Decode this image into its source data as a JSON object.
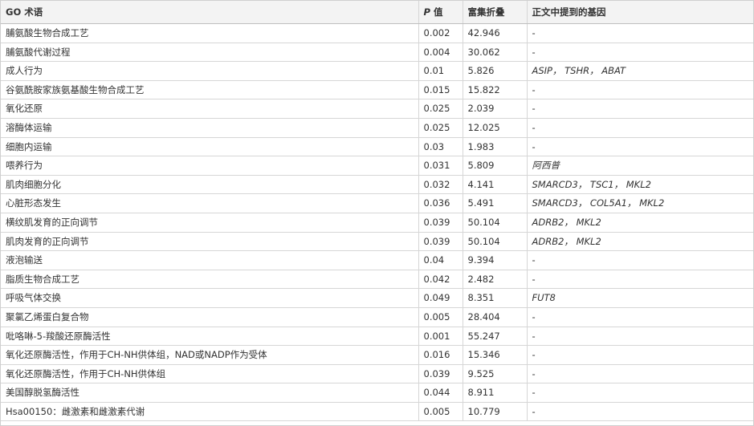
{
  "table": {
    "headers": {
      "go_term": "GO 术语",
      "p_prefix": "P",
      "p_suffix": " 值",
      "fold": "富集折叠",
      "genes": "正文中提到的基因"
    },
    "rows": [
      {
        "term": "脯氨酸生物合成工艺",
        "p": "0.002",
        "fold": "42.946",
        "genes": "-"
      },
      {
        "term": "脯氨酸代谢过程",
        "p": "0.004",
        "fold": "30.062",
        "genes": "-"
      },
      {
        "term": "成人行为",
        "p": "0.01",
        "fold": "5.826",
        "genes": "ASIP， TSHR， ABAT"
      },
      {
        "term": "谷氨酰胺家族氨基酸生物合成工艺",
        "p": "0.015",
        "fold": "15.822",
        "genes": "-"
      },
      {
        "term": "氧化还原",
        "p": "0.025",
        "fold": "2.039",
        "genes": "-"
      },
      {
        "term": "溶酶体运输",
        "p": "0.025",
        "fold": "12.025",
        "genes": "-"
      },
      {
        "term": "细胞内运输",
        "p": "0.03",
        "fold": "1.983",
        "genes": "-"
      },
      {
        "term": "喂养行为",
        "p": "0.031",
        "fold": "5.809",
        "genes": "阿西普"
      },
      {
        "term": "肌肉细胞分化",
        "p": "0.032",
        "fold": "4.141",
        "genes": "SMARCD3， TSC1， MKL2"
      },
      {
        "term": "心脏形态发生",
        "p": "0.036",
        "fold": "5.491",
        "genes": "SMARCD3， COL5A1， MKL2"
      },
      {
        "term": "横纹肌发育的正向调节",
        "p": "0.039",
        "fold": "50.104",
        "genes": "ADRB2， MKL2"
      },
      {
        "term": "肌肉发育的正向调节",
        "p": "0.039",
        "fold": "50.104",
        "genes": "ADRB2， MKL2"
      },
      {
        "term": "液泡输送",
        "p": "0.04",
        "fold": "9.394",
        "genes": "-"
      },
      {
        "term": "脂质生物合成工艺",
        "p": "0.042",
        "fold": "2.482",
        "genes": "-"
      },
      {
        "term": "呼吸气体交换",
        "p": "0.049",
        "fold": "8.351",
        "genes": "FUT8"
      },
      {
        "term": "聚氯乙烯蛋白复合物",
        "p": "0.005",
        "fold": "28.404",
        "genes": "-"
      },
      {
        "term": "吡咯啉-5-羧酸还原酶活性",
        "p": "0.001",
        "fold": "55.247",
        "genes": "-"
      },
      {
        "term": "氧化还原酶活性，作用于CH-NH供体组，NAD或NADP作为受体",
        "p": "0.016",
        "fold": "15.346",
        "genes": "-"
      },
      {
        "term": "氧化还原酶活性，作用于CH-NH供体组",
        "p": "0.039",
        "fold": "9.525",
        "genes": "-"
      },
      {
        "term": "美国醇脱氢酶活性",
        "p": "0.044",
        "fold": "8.911",
        "genes": "-"
      },
      {
        "term": "Hsa00150：雌激素和雌激素代谢",
        "p": "0.005",
        "fold": "10.779",
        "genes": "-"
      }
    ]
  }
}
